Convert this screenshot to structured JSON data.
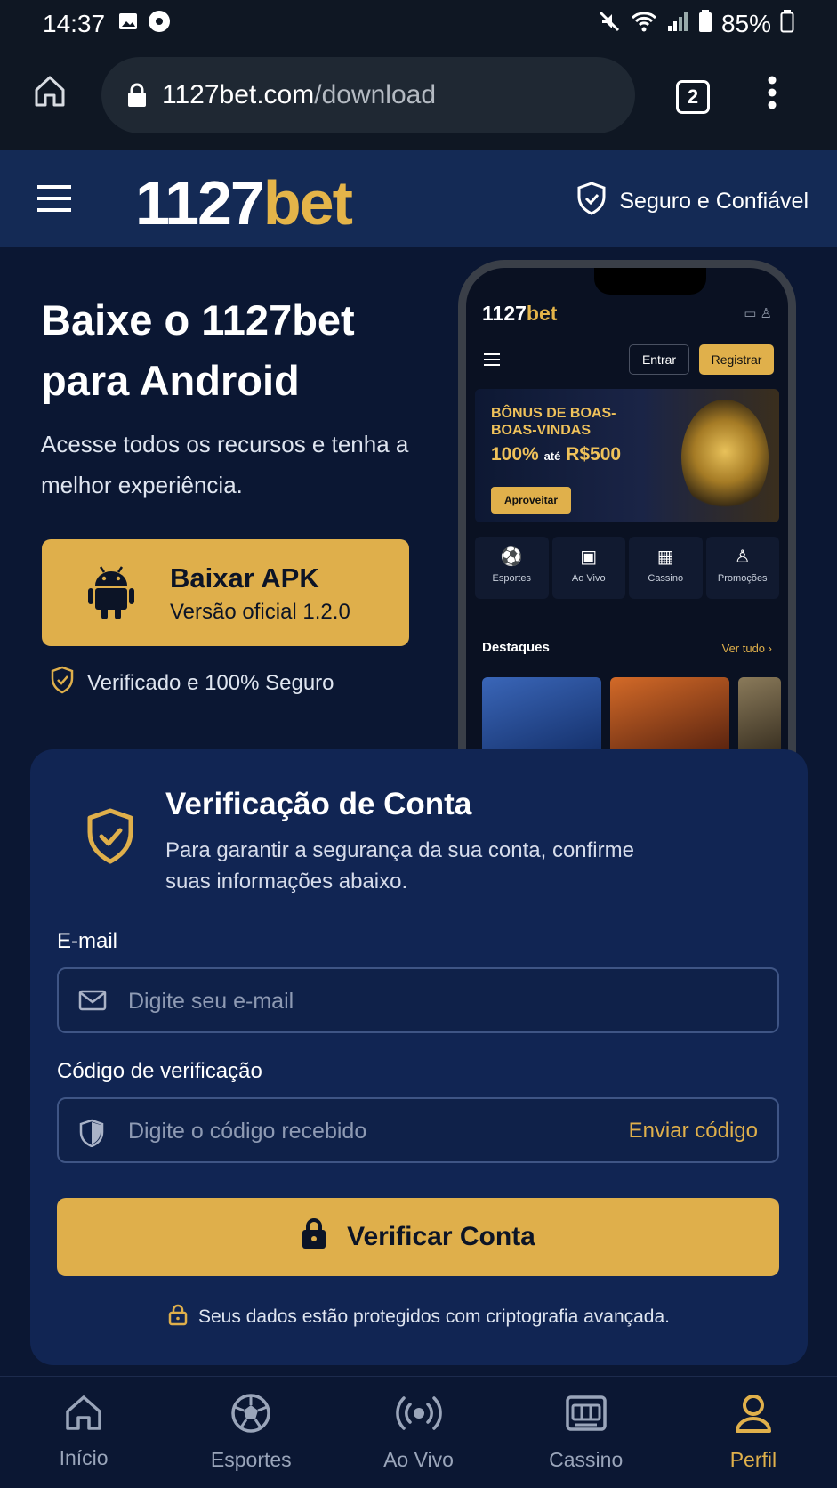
{
  "status_bar": {
    "time": "14:37",
    "battery": "85%"
  },
  "browser": {
    "url_host": "1127bet.com",
    "url_path": "/download",
    "tab_count": "2"
  },
  "header": {
    "logo_num": "1127",
    "logo_bet": "bet",
    "secure_label": "Seguro e Confiável"
  },
  "hero": {
    "title_line1": "Baixe o 1127bet",
    "title_line2": "para Android",
    "subtitle": "Acesse todos os recursos e tenha a melhor experiência.",
    "apk_title": "Baixar APK",
    "apk_version": "Versão oficial 1.2.0",
    "verified": "Verificado e 100% Seguro"
  },
  "phone": {
    "logo_num": "1127",
    "logo_bet": "bet",
    "login": "Entrar",
    "register": "Registrar",
    "banner_line1": "BÔNUS DE BOAS-BOAS-VINDAS",
    "banner_amount": "100%",
    "banner_ate": "até",
    "banner_value": "R$500",
    "banner_button": "Aproveitar",
    "categories": [
      "Esportes",
      "Ao Vivo",
      "Cassino",
      "Promoções"
    ],
    "highlights": "Destaques",
    "see_all": "Ver tudo"
  },
  "verification": {
    "title": "Verificação de Conta",
    "description": "Para garantir a segurança da sua conta, confirme suas informações abaixo.",
    "email_label": "E-mail",
    "email_placeholder": "Digite seu e-mail",
    "code_label": "Código de verificação",
    "code_placeholder": "Digite o código recebido",
    "send_code": "Enviar código",
    "verify_button": "Verificar Conta",
    "privacy": "Seus dados estão protegidos com criptografia avançada."
  },
  "bottom_nav": {
    "items": [
      {
        "label": "Início",
        "icon": "home-icon"
      },
      {
        "label": "Esportes",
        "icon": "soccer-ball-icon"
      },
      {
        "label": "Ao Vivo",
        "icon": "live-broadcast-icon"
      },
      {
        "label": "Cassino",
        "icon": "slot-machine-icon"
      },
      {
        "label": "Perfil",
        "icon": "user-icon"
      }
    ],
    "active": "Perfil"
  },
  "colors": {
    "accent": "#dfaf4b",
    "background": "#0b1733",
    "card": "#112553",
    "header": "#142a55"
  }
}
